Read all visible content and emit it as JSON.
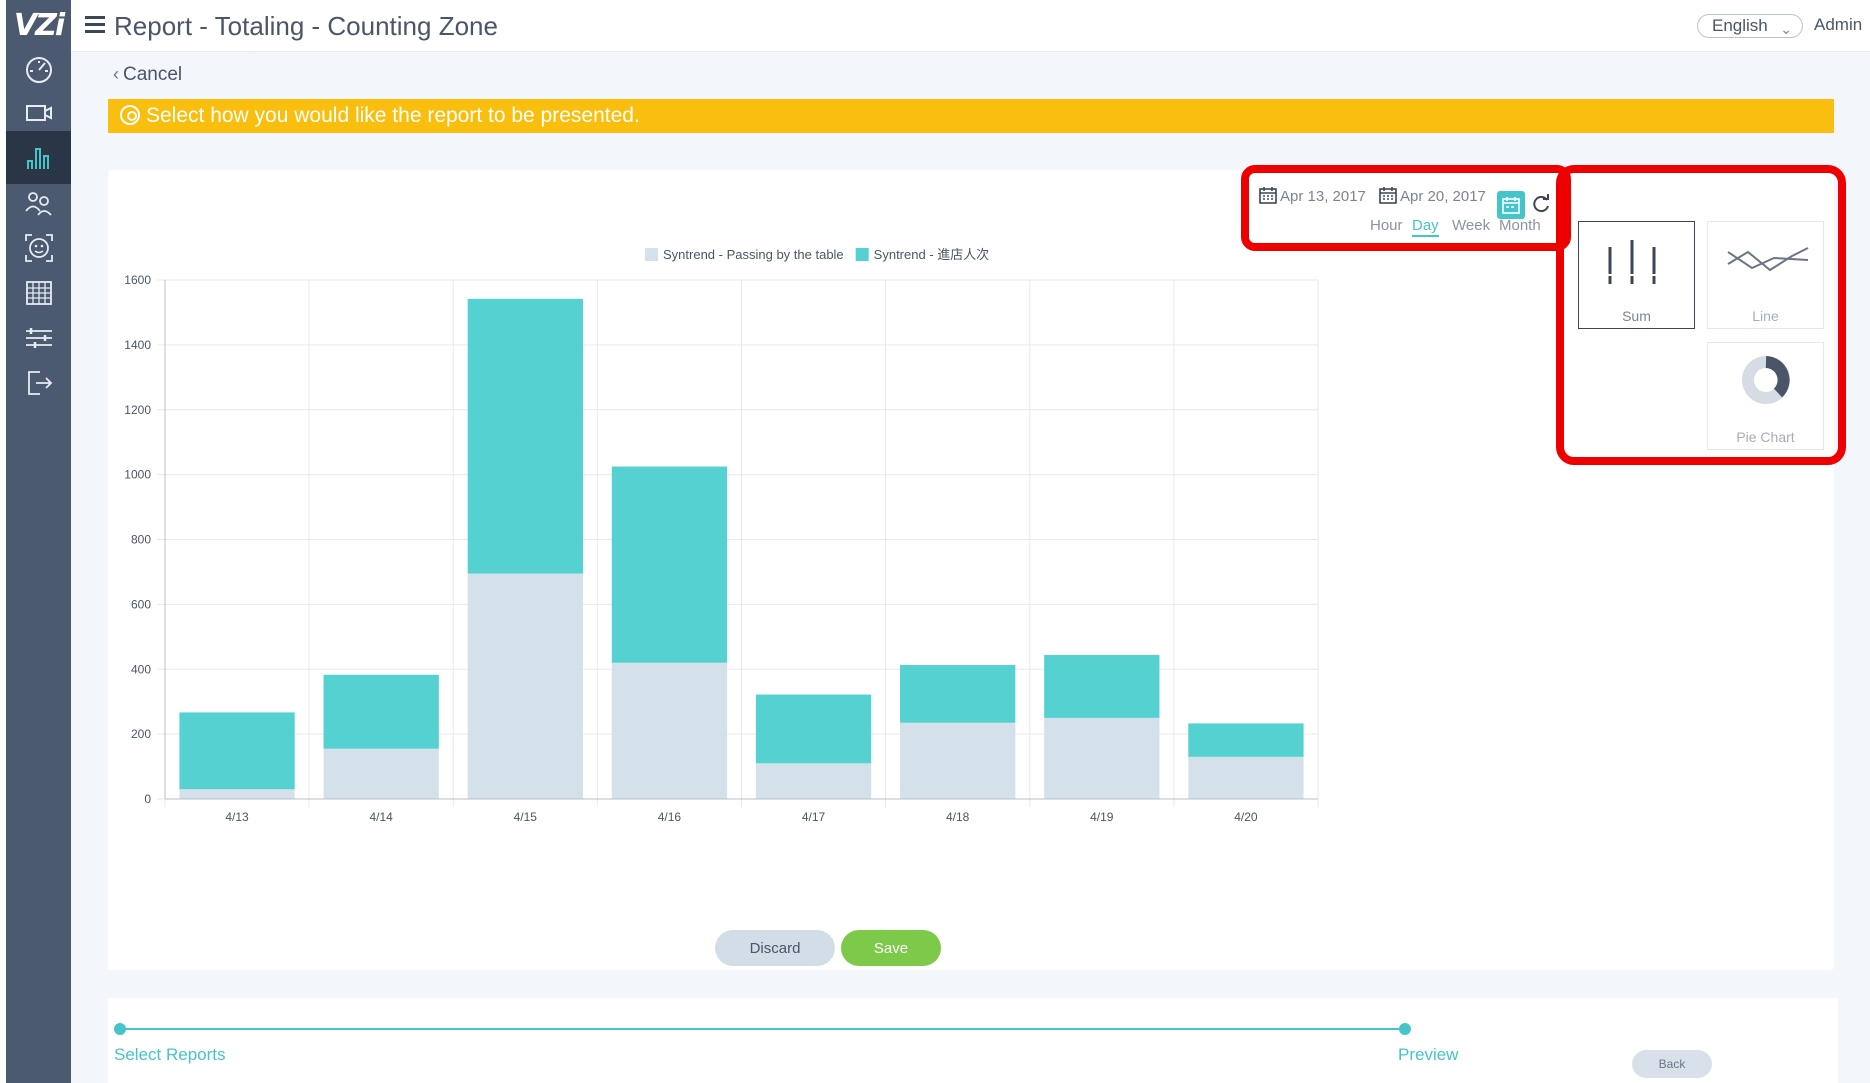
{
  "app": {
    "logo_text": "VZi",
    "title": "Report - Totaling - Counting Zone",
    "language": "English",
    "user": "Admin"
  },
  "sidebar": {
    "items": [
      {
        "icon": "dashboard-gauge-icon",
        "active": false
      },
      {
        "icon": "camera-icon",
        "active": false
      },
      {
        "icon": "bar-chart-icon",
        "active": true
      },
      {
        "icon": "people-flow-icon",
        "active": false
      },
      {
        "icon": "face-recognition-icon",
        "active": false
      },
      {
        "icon": "calendar-grid-icon",
        "active": false
      },
      {
        "icon": "settings-sliders-icon",
        "active": false
      },
      {
        "icon": "logout-icon",
        "active": false
      }
    ]
  },
  "page": {
    "cancel_label": "Cancel",
    "notice": "Select how you would like the report to be presented."
  },
  "date_controls": {
    "start_date": "Apr 13, 2017",
    "end_date": "Apr 20, 2017",
    "granularity": [
      "Hour",
      "Day",
      "Week",
      "Month"
    ],
    "selected_granularity": "Day"
  },
  "chart_types": {
    "options": [
      {
        "label": "Sum",
        "selected": true
      },
      {
        "label": "Line",
        "selected": false
      },
      {
        "label": "Pie Chart",
        "selected": false
      }
    ]
  },
  "buttons": {
    "discard": "Discard",
    "save": "Save",
    "back": "Back"
  },
  "wizard": {
    "steps": [
      "Select Reports",
      "Preview"
    ]
  },
  "colors": {
    "accent": "#45c4cb",
    "banner": "#f9be0e",
    "sidebar": "#4b5a70",
    "series_light": "#d5e1ea",
    "series_teal": "#55d1d1",
    "highlight_frame": "#ee0000",
    "save": "#7dc94a"
  },
  "chart_data": {
    "type": "bar",
    "stacked": true,
    "categories": [
      "4/13",
      "4/14",
      "4/15",
      "4/16",
      "4/17",
      "4/18",
      "4/19",
      "4/20"
    ],
    "series": [
      {
        "name": "Syntrend - Passing by the table",
        "values": [
          30,
          155,
          695,
          420,
          110,
          235,
          250,
          130
        ]
      },
      {
        "name": "Syntrend - 進店人次",
        "values": [
          237,
          228,
          847,
          605,
          212,
          178,
          194,
          103
        ]
      }
    ],
    "y_ticks": [
      0,
      200,
      400,
      600,
      800,
      1000,
      1200,
      1400,
      1600
    ],
    "ylim": [
      0,
      1600
    ],
    "grid": true,
    "legend": "top"
  }
}
